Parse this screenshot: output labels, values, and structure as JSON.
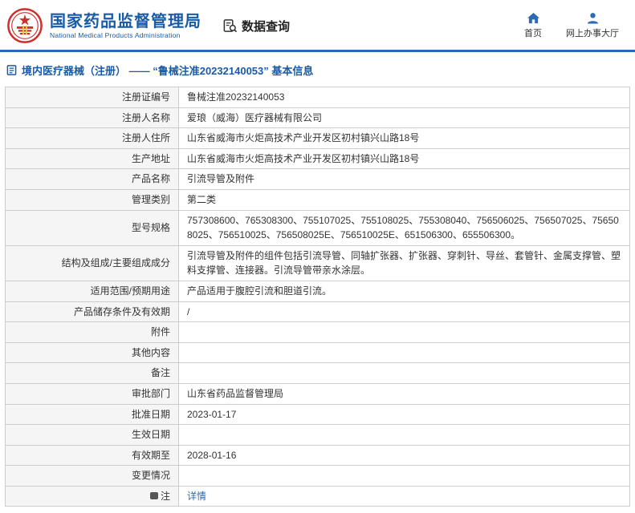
{
  "header": {
    "title": "国家药品监督管理局",
    "subtitle": "National Medical Products Administration",
    "data_query": "数据查询",
    "home_label": "首页",
    "hall_label": "网上办事大厅"
  },
  "breadcrumb": {
    "text": "境内医疗器械（注册） ——  “鲁械注准20232140053”  基本信息"
  },
  "colors": {
    "brand_blue": "#1a5ba6",
    "line_blue": "#2b6bb2",
    "emblem_red": "#cf2e2e",
    "link_blue": "#2b6bb2",
    "label_bg": "#f5f5f5",
    "border_gray": "#cccccc"
  },
  "table": {
    "rows": [
      {
        "label": "注册证编号",
        "value": "鲁械注准20232140053"
      },
      {
        "label": "注册人名称",
        "value": "爱琅（威海）医疗器械有限公司"
      },
      {
        "label": "注册人住所",
        "value": "山东省威海市火炬高技术产业开发区初村镇兴山路18号"
      },
      {
        "label": "生产地址",
        "value": "山东省威海市火炬高技术产业开发区初村镇兴山路18号"
      },
      {
        "label": "产品名称",
        "value": "引流导管及附件"
      },
      {
        "label": "管理类别",
        "value": "第二类"
      },
      {
        "label": "型号规格",
        "value": "757308600、765308300、755107025、755108025、755308040、756506025、756507025、756508025、756510025、756508025E、756510025E、651506300、655506300。"
      },
      {
        "label": "结构及组成/主要组成成分",
        "value": "引流导管及附件的组件包括引流导管、同轴扩张器、扩张器、穿刺针、导丝、套管针、金属支撑管、塑料支撑管、连接器。引流导管带亲水涂层。"
      },
      {
        "label": "适用范围/预期用途",
        "value": "产品适用于腹腔引流和胆道引流。"
      },
      {
        "label": "产品储存条件及有效期",
        "value": "/"
      },
      {
        "label": "附件",
        "value": ""
      },
      {
        "label": "其他内容",
        "value": ""
      },
      {
        "label": "备注",
        "value": ""
      },
      {
        "label": "审批部门",
        "value": "山东省药品监督管理局"
      },
      {
        "label": "批准日期",
        "value": "2023-01-17"
      },
      {
        "label": "生效日期",
        "value": ""
      },
      {
        "label": "有效期至",
        "value": "2028-01-16"
      },
      {
        "label": "变更情况",
        "value": ""
      },
      {
        "label": "注",
        "value": "详情",
        "link": true,
        "label_icon": "note-icon"
      }
    ]
  }
}
